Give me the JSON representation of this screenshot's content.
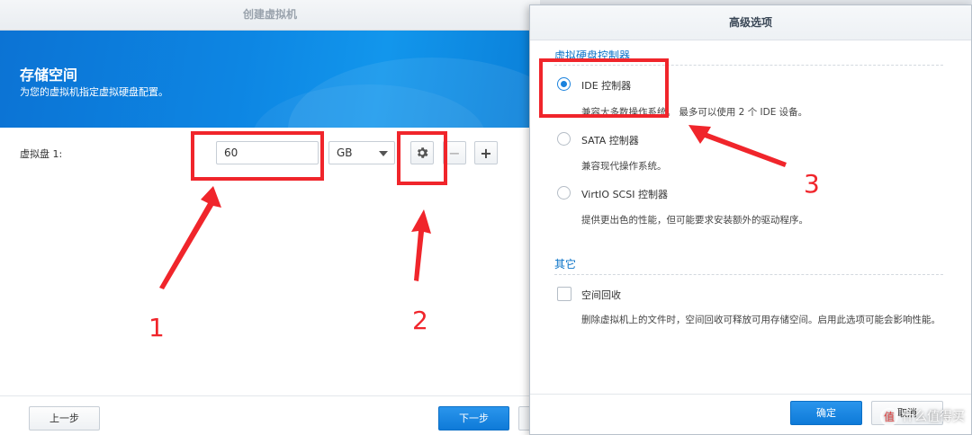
{
  "wizard": {
    "title": "创建虚拟机",
    "banner_title": "存储空间",
    "banner_subtitle": "为您的虚拟机指定虚拟硬盘配置。",
    "disk_label": "虚拟盘 1:",
    "size_value": "60",
    "unit_value": "GB",
    "minus_label": "−",
    "plus_label": "+",
    "prev_button": "上一步",
    "next_button": "下一步"
  },
  "dialog": {
    "title": "高级选项",
    "controller_section": "虚拟硬盘控制器",
    "options": [
      {
        "label": "IDE 控制器",
        "desc": "兼容大多数操作系统。 最多可以使用 2 个 IDE 设备。",
        "checked": true
      },
      {
        "label": "SATA 控制器",
        "desc": "兼容现代操作系统。",
        "checked": false
      },
      {
        "label": "VirtIO SCSI 控制器",
        "desc": "提供更出色的性能，但可能要求安装额外的驱动程序。",
        "checked": false
      }
    ],
    "other_section": "其它",
    "space_reclaim_label": "空间回收",
    "space_reclaim_checked": false,
    "space_reclaim_desc": "删除虚拟机上的文件时，空间回收可释放可用存储空间。启用此选项可能会影响性能。",
    "ok_button": "确定",
    "cancel_button": "取消"
  },
  "annotations": {
    "colors": {
      "annotation": "#f0252b",
      "accent": "#0a73c8"
    },
    "labels": [
      "1",
      "2",
      "3"
    ]
  },
  "watermark": {
    "icon": "值",
    "text": "什么值得买"
  }
}
